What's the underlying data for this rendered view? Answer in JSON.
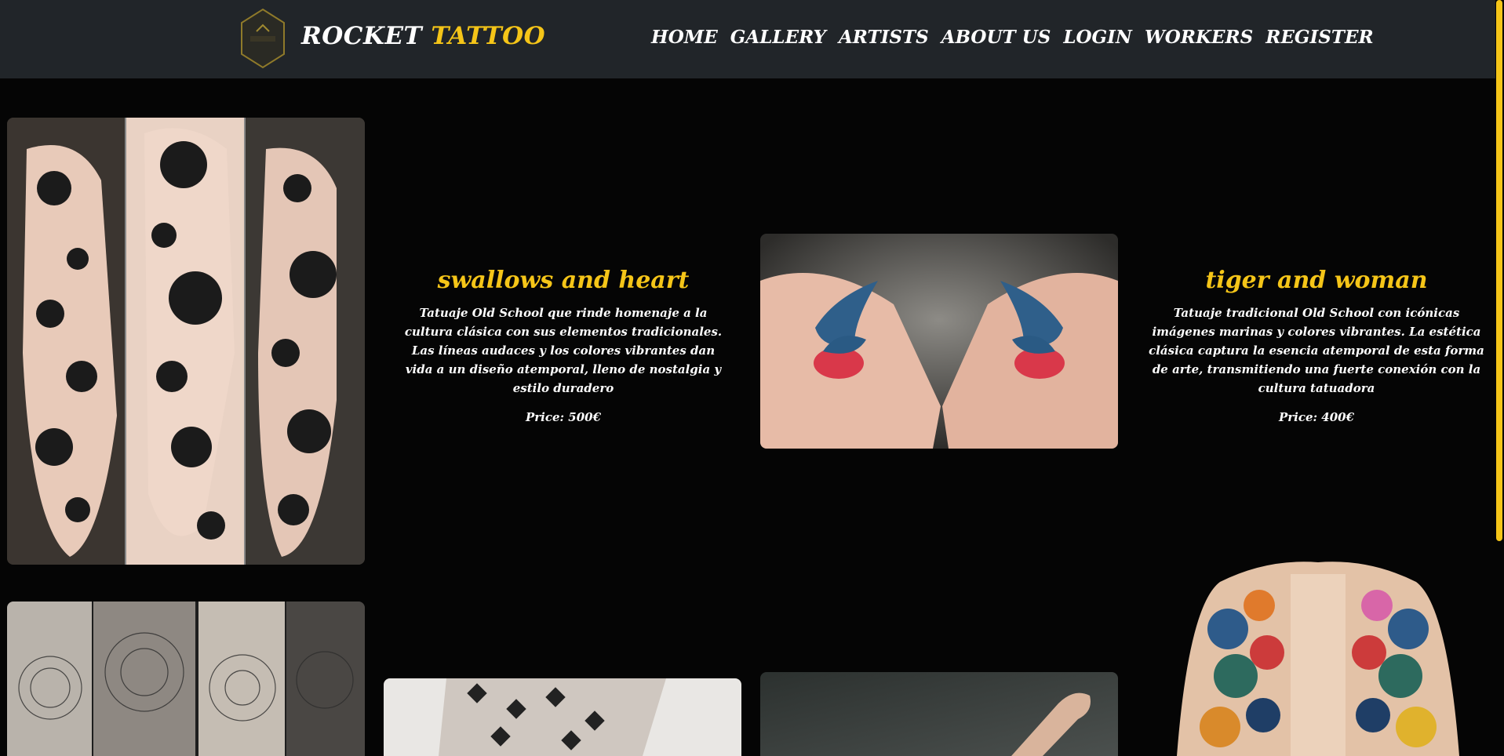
{
  "header": {
    "brand_part1": "ROCKET",
    "brand_part2": "TATTOO",
    "logo_text": "ROCKET TATTOO",
    "nav": [
      "HOME",
      "GALLERY",
      "ARTISTS",
      "ABOUT US",
      "LOGIN",
      "WORKERS",
      "REGISTER"
    ]
  },
  "colors": {
    "accent": "#f5c518",
    "navbar_bg": "#212529",
    "page_bg": "#050505"
  },
  "gallery": {
    "items": [
      {
        "title": "swallows and heart",
        "description": "Tatuaje Old School que rinde homenaje a la cultura clásica con sus elementos tradicionales. Las líneas audaces y los colores vibrantes dan vida a un diseño atemporal, lleno de nostalgia y estilo duradero",
        "price": "Price: 500€"
      },
      {
        "title": "tiger and woman",
        "description": "Tatuaje tradicional Old School con icónicas imágenes marinas y colores vibrantes. La estética clásica captura la esencia atemporal de esta forma de arte, transmitiendo una fuerte conexión con la cultura tatuadora",
        "price": "Price: 400€"
      }
    ]
  }
}
